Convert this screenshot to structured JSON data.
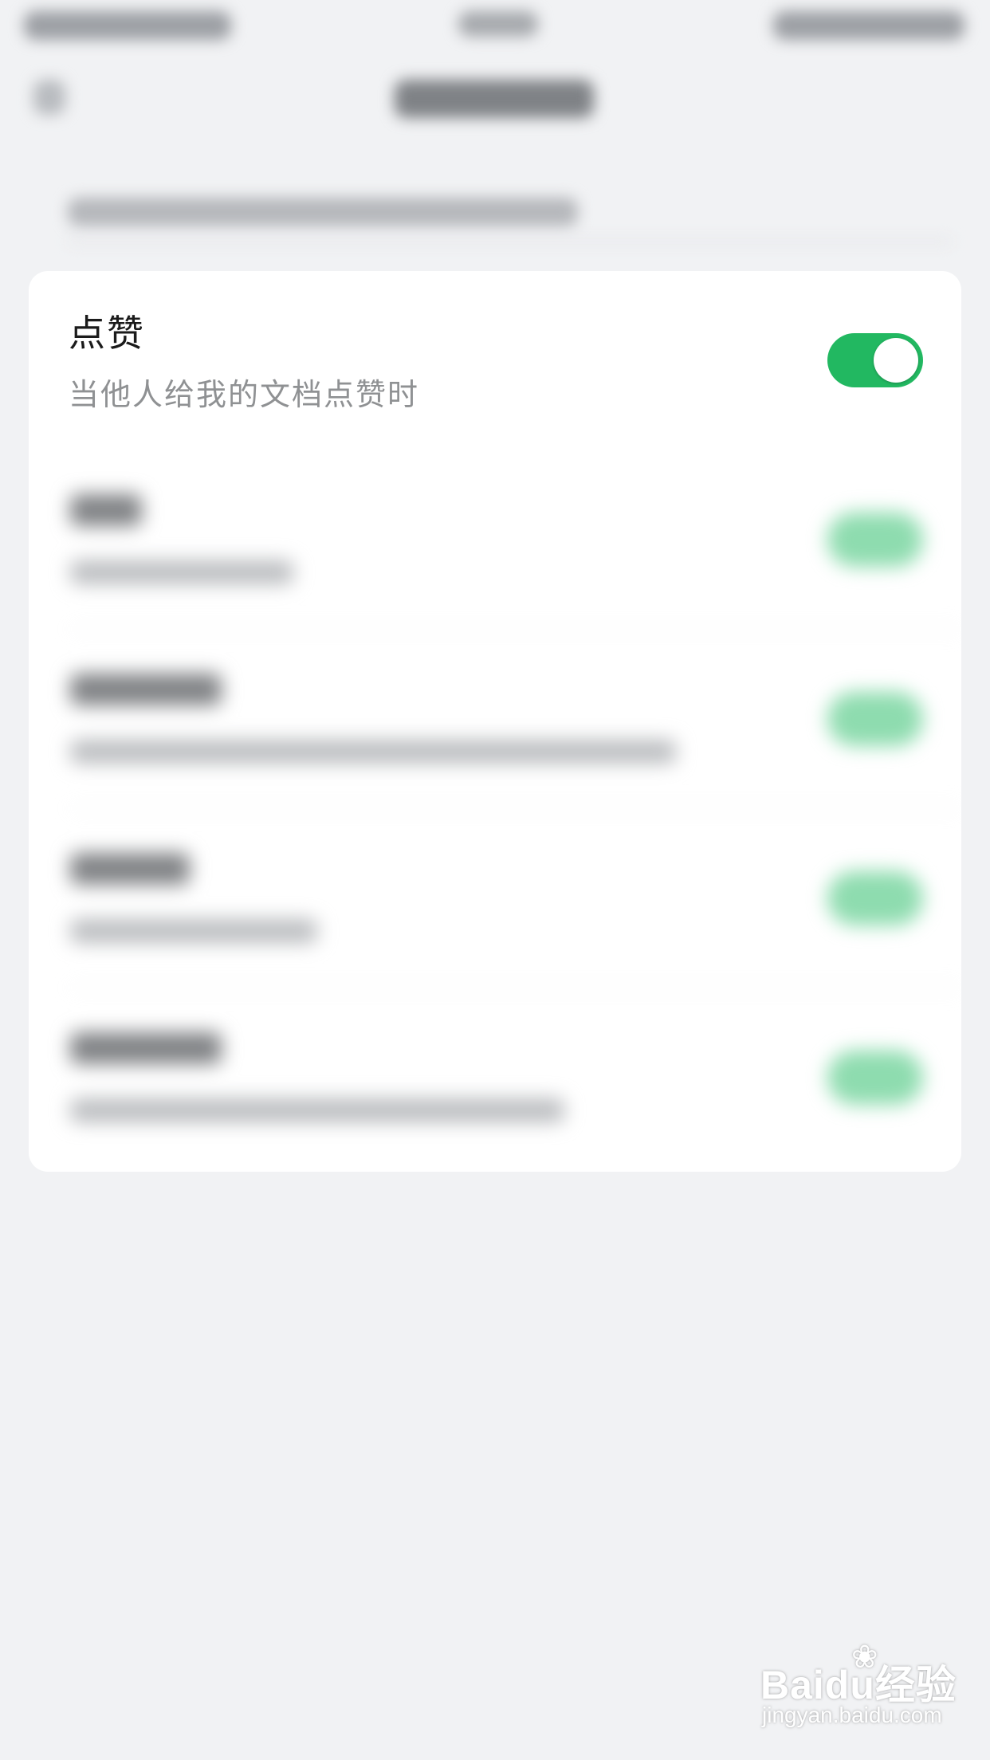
{
  "setting": {
    "title": "点赞",
    "description": "当他人给我的文档点赞时",
    "enabled": true
  },
  "colors": {
    "page_background": "#f1f2f4",
    "card_background": "#ffffff",
    "toggle_on": "#22b861",
    "toggle_on_blurred": "#8edcaf"
  },
  "blurred_rows": [
    {
      "toggle": "on"
    },
    {
      "toggle": "on"
    },
    {
      "toggle": "on"
    },
    {
      "toggle": "on"
    }
  ],
  "watermark": {
    "brand": "Baidu经验",
    "url": "jingyan.baidu.com"
  }
}
